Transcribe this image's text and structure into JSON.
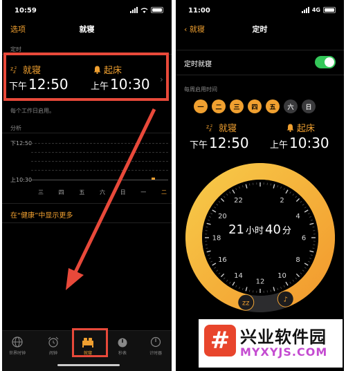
{
  "left": {
    "status": {
      "time": "10:59"
    },
    "nav": {
      "left": "选项",
      "title": "就寝"
    },
    "schedule_label": "定时",
    "bedtime": {
      "label": "就寝",
      "prefix": "下午",
      "time": "12:50"
    },
    "wake": {
      "label": "起床",
      "prefix": "上午",
      "time": "10:30"
    },
    "weekday_note": "每个工作日启用。",
    "analysis_label": "分析",
    "chart": {
      "top_label": "下12:50",
      "bottom_label": "上10:30",
      "days": [
        "三",
        "四",
        "五",
        "六",
        "日",
        "一",
        "二"
      ],
      "highlight_day": "二"
    },
    "health_link": "在“健康”中显示更多",
    "tabs": [
      "世界时钟",
      "闹钟",
      "就寝",
      "秒表",
      "计时器"
    ]
  },
  "right": {
    "status": {
      "time": "11:00",
      "network": "4G"
    },
    "nav": {
      "back": "就寝",
      "title": "定时"
    },
    "schedule_toggle_label": "定时就寝",
    "schedule_on": true,
    "repeat_label": "每周启用时间",
    "days": [
      {
        "label": "一",
        "on": true
      },
      {
        "label": "二",
        "on": true
      },
      {
        "label": "三",
        "on": true
      },
      {
        "label": "四",
        "on": true
      },
      {
        "label": "五",
        "on": true
      },
      {
        "label": "六",
        "on": false
      },
      {
        "label": "日",
        "on": false
      }
    ],
    "bedtime": {
      "label": "就寝",
      "prefix": "下午",
      "time": "12:50"
    },
    "wake": {
      "label": "起床",
      "prefix": "上午",
      "time": "10:30"
    },
    "duration": {
      "hours": "21",
      "hours_unit": "小时",
      "minutes": "40",
      "minutes_unit": "分"
    },
    "clock_numbers": [
      "12",
      "2",
      "4",
      "6",
      "8",
      "10",
      "14",
      "16",
      "18",
      "20",
      "22"
    ]
  },
  "watermark": {
    "logo": "#",
    "title": "兴业软件园",
    "url": "MYXYJS.COM"
  },
  "colors": {
    "accent": "#f0a030",
    "highlight": "#e8493a",
    "toggle_on": "#34c759"
  }
}
